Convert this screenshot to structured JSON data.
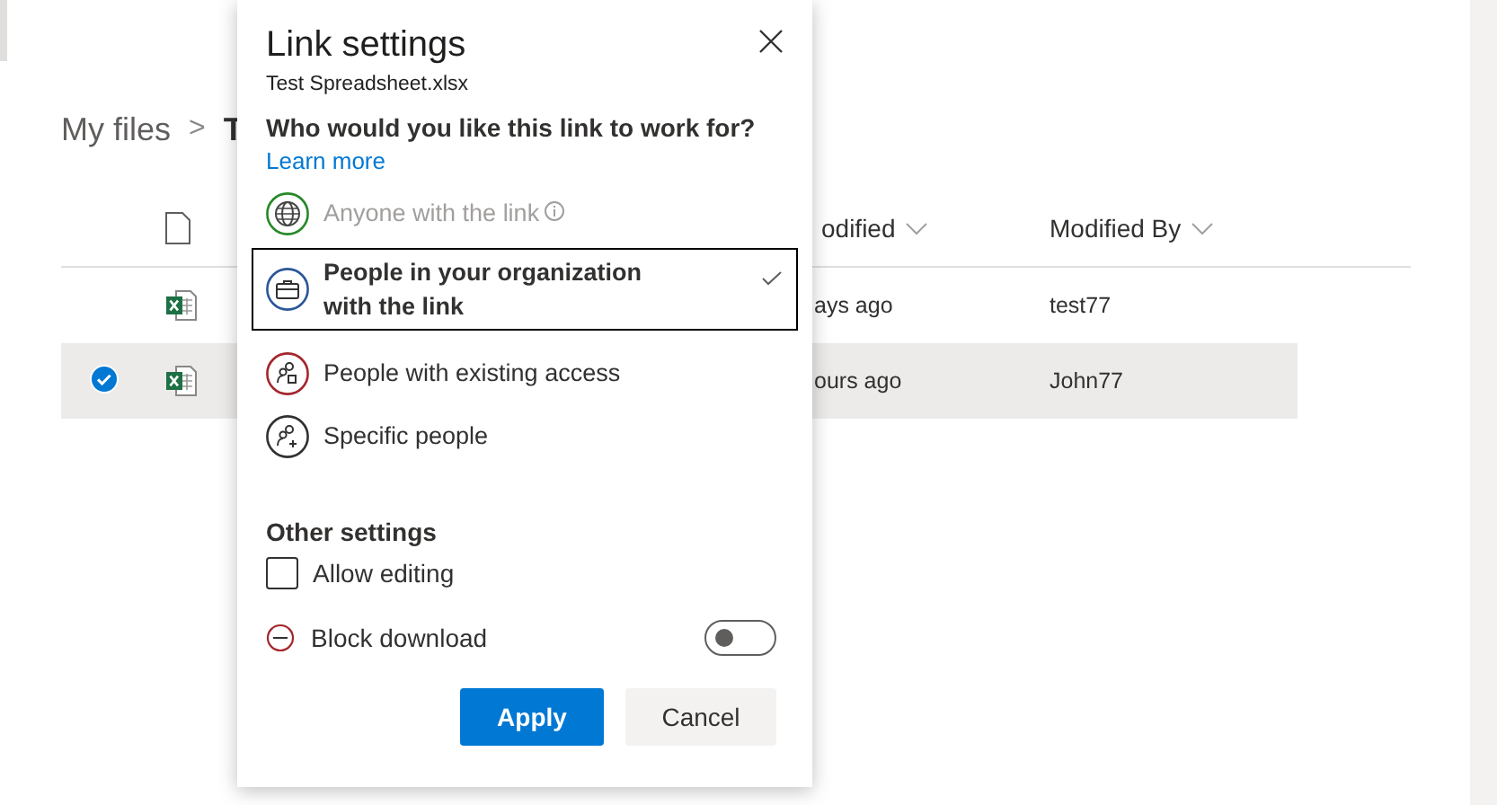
{
  "breadcrumb": {
    "items": [
      "My files",
      "T"
    ],
    "separator": ">"
  },
  "table": {
    "columns": [
      "odified",
      "Modified By"
    ],
    "rows": [
      {
        "modified": "ays ago",
        "modified_by": "test77",
        "selected": false
      },
      {
        "modified": "ours ago",
        "modified_by": "John77",
        "selected": true
      }
    ]
  },
  "dialog": {
    "title": "Link settings",
    "file_name": "Test Spreadsheet.xlsx",
    "question": "Who would you like this link to work for?",
    "learn_more": "Learn more",
    "options": [
      {
        "kind": "anyone",
        "label": "Anyone with the link",
        "disabled": true,
        "selected": false,
        "info": true
      },
      {
        "kind": "organization",
        "label": "People in your organization with the link",
        "disabled": false,
        "selected": true,
        "info": false
      },
      {
        "kind": "existing",
        "label": "People with existing access",
        "disabled": false,
        "selected": false,
        "info": false
      },
      {
        "kind": "specific",
        "label": "Specific people",
        "disabled": false,
        "selected": false,
        "info": false
      }
    ],
    "other_settings": "Other settings",
    "allow_editing": {
      "label": "Allow editing",
      "checked": false
    },
    "block_download": {
      "label": "Block download",
      "on": false
    },
    "buttons": {
      "apply": "Apply",
      "cancel": "Cancel"
    }
  }
}
